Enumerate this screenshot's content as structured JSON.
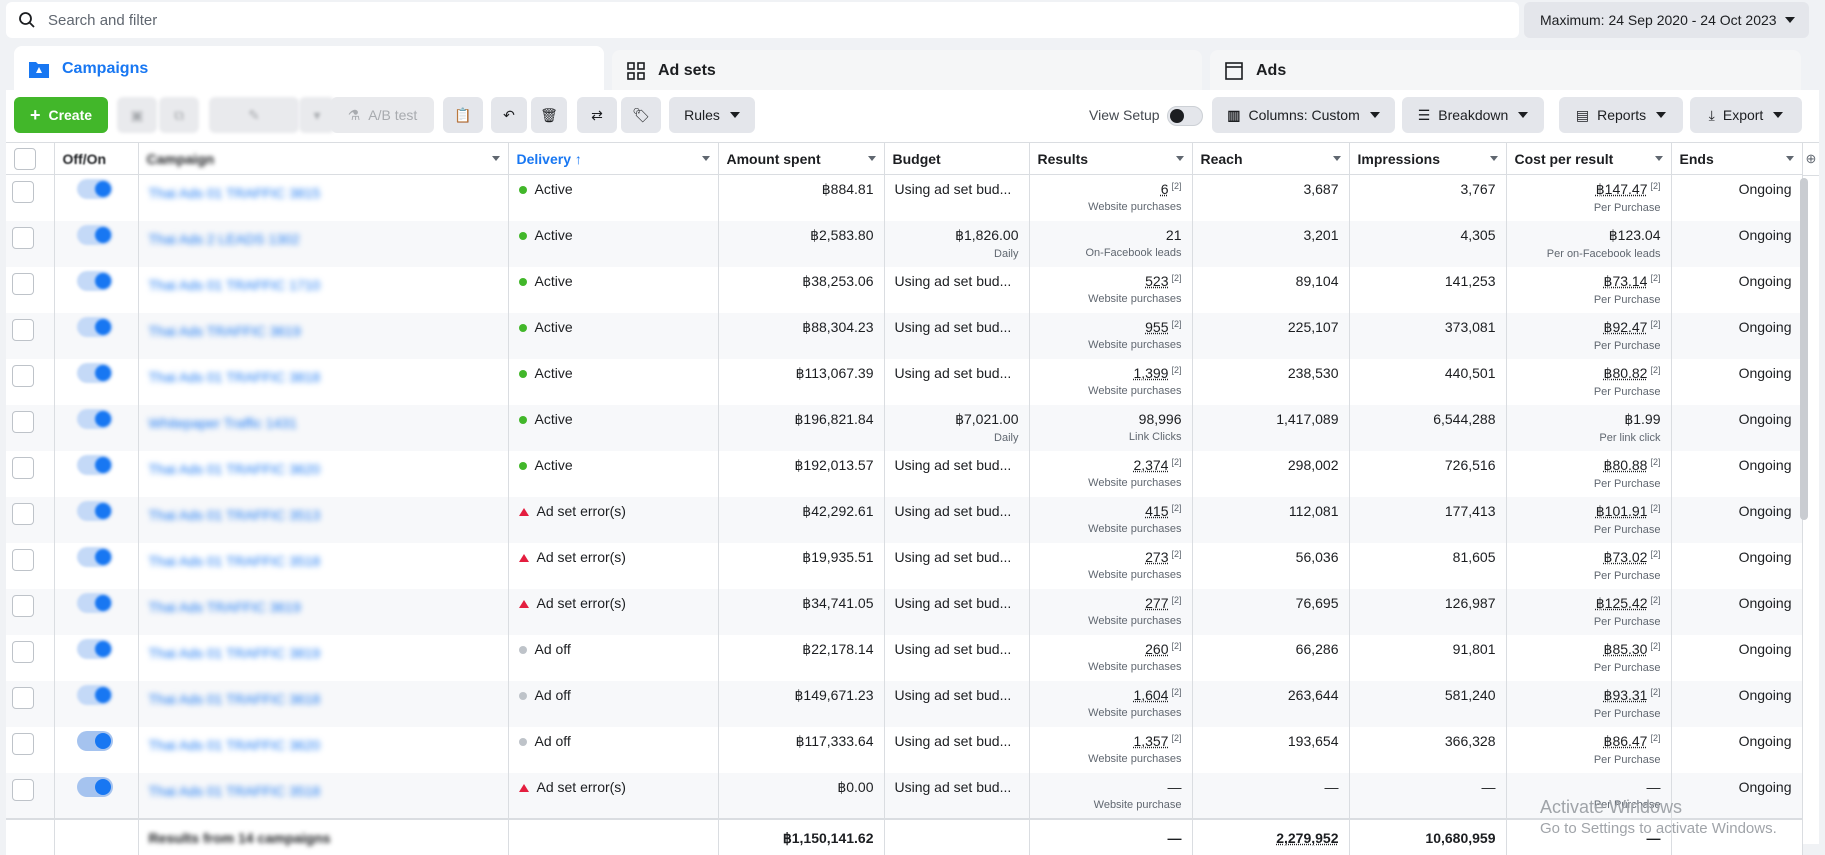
{
  "search": {
    "placeholder": "Search and filter"
  },
  "date_range": {
    "label": "Maximum: 24 Sep 2020 - 24 Oct 2023"
  },
  "tabs": [
    {
      "label": "Campaigns",
      "icon": "folder-icon"
    },
    {
      "label": "Ad sets",
      "icon": "grid-icon"
    },
    {
      "label": "Ads",
      "icon": "ad-page-icon"
    }
  ],
  "toolbar": {
    "create": "Create",
    "ab_test": "A/B test",
    "rules": "Rules",
    "view_setup": "View Setup",
    "columns": "Columns: Custom",
    "breakdown": "Breakdown",
    "reports": "Reports",
    "export": "Export"
  },
  "columns": {
    "offon": "Off/On",
    "campaign": "Campaign",
    "delivery": "Delivery",
    "amount_spent": "Amount spent",
    "budget": "Budget",
    "results": "Results",
    "reach": "Reach",
    "impressions": "Impressions",
    "cost_per_result": "Cost per result",
    "ends": "Ends"
  },
  "rows": [
    {
      "name": "Thai Ads 01 TRAFFIC 3815",
      "delivery": "Active",
      "status": "active",
      "spent": "฿884.81",
      "budget": "Using ad set bud...",
      "budget_sub": "",
      "results": "6",
      "results_sub": "Website purchases",
      "reach": "3,687",
      "impressions": "3,767",
      "cost": "฿147.47",
      "cost_sub": "Per Purchase",
      "ends": "Ongoing"
    },
    {
      "name": "Thai Ads 2 LEADS 1302",
      "delivery": "Active",
      "status": "active",
      "spent": "฿2,583.80",
      "budget": "฿1,826.00",
      "budget_sub": "Daily",
      "results": "21",
      "results_sub": "On-Facebook leads",
      "reach": "3,201",
      "impressions": "4,305",
      "cost": "฿123.04",
      "cost_sub": "Per on-Facebook leads",
      "ends": "Ongoing"
    },
    {
      "name": "Thai Ads 01 TRAFFIC 1710",
      "delivery": "Active",
      "status": "active",
      "spent": "฿38,253.06",
      "budget": "Using ad set bud...",
      "budget_sub": "",
      "results": "523",
      "results_sub": "Website purchases",
      "reach": "89,104",
      "impressions": "141,253",
      "cost": "฿73.14",
      "cost_sub": "Per Purchase",
      "ends": "Ongoing"
    },
    {
      "name": "Thai Ads TRAFFIC 3619",
      "delivery": "Active",
      "status": "active",
      "spent": "฿88,304.23",
      "budget": "Using ad set bud...",
      "budget_sub": "",
      "results": "955",
      "results_sub": "Website purchases",
      "reach": "225,107",
      "impressions": "373,081",
      "cost": "฿92.47",
      "cost_sub": "Per Purchase",
      "ends": "Ongoing"
    },
    {
      "name": "Thai Ads 01 TRAFFIC 3818",
      "delivery": "Active",
      "status": "active",
      "spent": "฿113,067.39",
      "budget": "Using ad set bud...",
      "budget_sub": "",
      "results": "1,399",
      "results_sub": "Website purchases",
      "reach": "238,530",
      "impressions": "440,501",
      "cost": "฿80.82",
      "cost_sub": "Per Purchase",
      "ends": "Ongoing"
    },
    {
      "name": "Whitepaper Traffic 1431",
      "delivery": "Active",
      "status": "active",
      "spent": "฿196,821.84",
      "budget": "฿7,021.00",
      "budget_sub": "Daily",
      "results": "98,996",
      "results_sub": "Link Clicks",
      "reach": "1,417,089",
      "impressions": "6,544,288",
      "cost": "฿1.99",
      "cost_sub": "Per link click",
      "ends": "Ongoing"
    },
    {
      "name": "Thai Ads 01 TRAFFIC 3620",
      "delivery": "Active",
      "status": "active",
      "spent": "฿192,013.57",
      "budget": "Using ad set bud...",
      "budget_sub": "",
      "results": "2,374",
      "results_sub": "Website purchases",
      "reach": "298,002",
      "impressions": "726,516",
      "cost": "฿80.88",
      "cost_sub": "Per Purchase",
      "ends": "Ongoing"
    },
    {
      "name": "Thai Ads 01 TRAFFIC 3513",
      "delivery": "Ad set error(s)",
      "status": "error",
      "spent": "฿42,292.61",
      "budget": "Using ad set bud...",
      "budget_sub": "",
      "results": "415",
      "results_sub": "Website purchases",
      "reach": "112,081",
      "impressions": "177,413",
      "cost": "฿101.91",
      "cost_sub": "Per Purchase",
      "ends": "Ongoing"
    },
    {
      "name": "Thai Ads 01 TRAFFIC 3518",
      "delivery": "Ad set error(s)",
      "status": "error",
      "spent": "฿19,935.51",
      "budget": "Using ad set bud...",
      "budget_sub": "",
      "results": "273",
      "results_sub": "Website purchases",
      "reach": "56,036",
      "impressions": "81,605",
      "cost": "฿73.02",
      "cost_sub": "Per Purchase",
      "ends": "Ongoing"
    },
    {
      "name": "Thai Ads TRAFFIC 3619",
      "delivery": "Ad set error(s)",
      "status": "error",
      "spent": "฿34,741.05",
      "budget": "Using ad set bud...",
      "budget_sub": "",
      "results": "277",
      "results_sub": "Website purchases",
      "reach": "76,695",
      "impressions": "126,987",
      "cost": "฿125.42",
      "cost_sub": "Per Purchase",
      "ends": "Ongoing"
    },
    {
      "name": "Thai Ads 01 TRAFFIC 3819",
      "delivery": "Ad off",
      "status": "off",
      "spent": "฿22,178.14",
      "budget": "Using ad set bud...",
      "budget_sub": "",
      "results": "260",
      "results_sub": "Website purchases",
      "reach": "66,286",
      "impressions": "91,801",
      "cost": "฿85.30",
      "cost_sub": "Per Purchase",
      "ends": "Ongoing"
    },
    {
      "name": "Thai Ads 01 TRAFFIC 3618",
      "delivery": "Ad off",
      "status": "off",
      "spent": "฿149,671.23",
      "budget": "Using ad set bud...",
      "budget_sub": "",
      "results": "1,604",
      "results_sub": "Website purchases",
      "reach": "263,644",
      "impressions": "581,240",
      "cost": "฿93.31",
      "cost_sub": "Per Purchase",
      "ends": "Ongoing"
    },
    {
      "name": "Thai Ads 01 TRAFFIC 3620",
      "delivery": "Ad off",
      "status": "off",
      "spent": "฿117,333.64",
      "budget": "Using ad set bud...",
      "budget_sub": "",
      "results": "1,357",
      "results_sub": "Website purchases",
      "reach": "193,654",
      "impressions": "366,328",
      "cost": "฿86.47",
      "cost_sub": "Per Purchase",
      "ends": "Ongoing"
    },
    {
      "name": "Thai Ads 01 TRAFFIC 3518",
      "delivery": "Ad set error(s)",
      "status": "error",
      "spent": "฿0.00",
      "budget": "Using ad set bud...",
      "budget_sub": "",
      "results": "—",
      "results_sub": "Website purchase",
      "reach": "—",
      "impressions": "—",
      "cost": "—",
      "cost_sub": "Per Purchase",
      "ends": "Ongoing"
    }
  ],
  "totals": {
    "label": "Results from 14 campaigns",
    "spent": "฿1,150,141.62",
    "results": "—",
    "reach": "2,279,952",
    "impressions": "10,680,959",
    "cost": "—"
  },
  "watermark": {
    "line1": "Activate Windows",
    "line2": "Go to Settings to activate Windows."
  },
  "colors": {
    "accent": "#1877f2",
    "create": "#42b72a",
    "active": "#42b72a",
    "error": "#e41e3f",
    "off": "#bec3c9"
  }
}
